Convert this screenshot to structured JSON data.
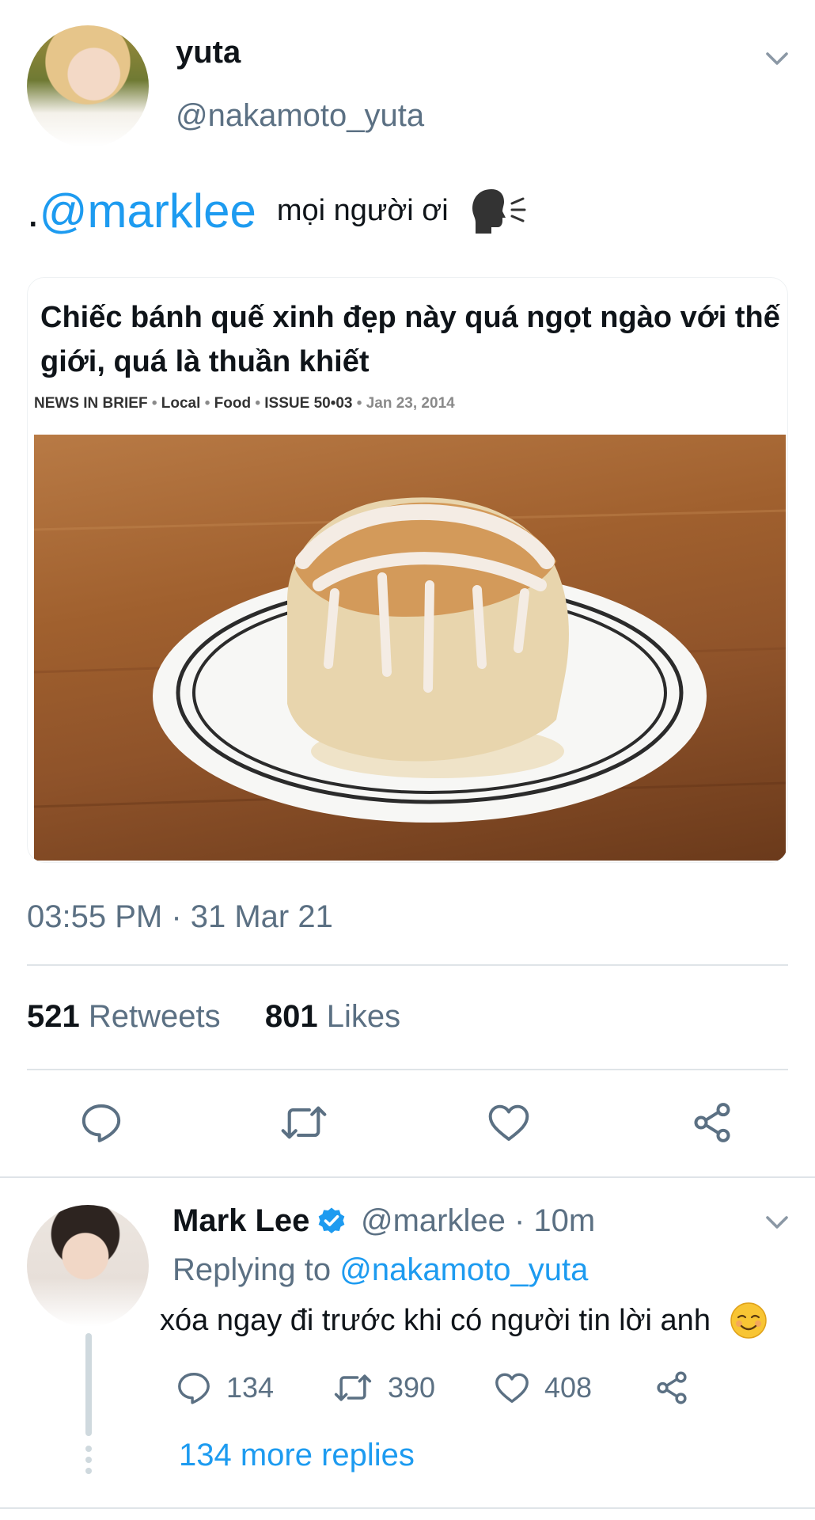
{
  "tweet": {
    "author_name": "yuta",
    "author_handle": "@nakamoto_yuta",
    "text_prefix": ".",
    "text_mention": "@marklee",
    "text_body": "mọi người ơi",
    "text_emoji": "speaking-head-emoji",
    "card": {
      "title": "Chiếc bánh quế xinh đẹp này quá ngọt ngào với thế giới, quá là thuần khiết",
      "meta": {
        "section": "NEWS IN BRIEF",
        "sep": "•",
        "local": "Local",
        "food": "Food",
        "issue": "ISSUE 50•03",
        "date": "Jan 23, 2014"
      }
    },
    "timestamp": "03:55 PM · 31 Mar 21",
    "retweets_count": "521",
    "retweets_label": "Retweets",
    "likes_count": "801",
    "likes_label": "Likes"
  },
  "reply": {
    "author_name": "Mark Lee",
    "author_handle": "@marklee · 10m",
    "replying_label": "Replying to",
    "replying_to": "@nakamoto_yuta",
    "text": "xóa ngay đi trước khi có người tin lời anh",
    "emoji": "smiling-face-emoji",
    "reply_count": "134",
    "retweet_count": "390",
    "like_count": "408",
    "more_replies": "134 more replies"
  },
  "colors": {
    "accent": "#1d9bf0",
    "secondary_text": "#5b7083",
    "divider": "#dfe4e8"
  }
}
